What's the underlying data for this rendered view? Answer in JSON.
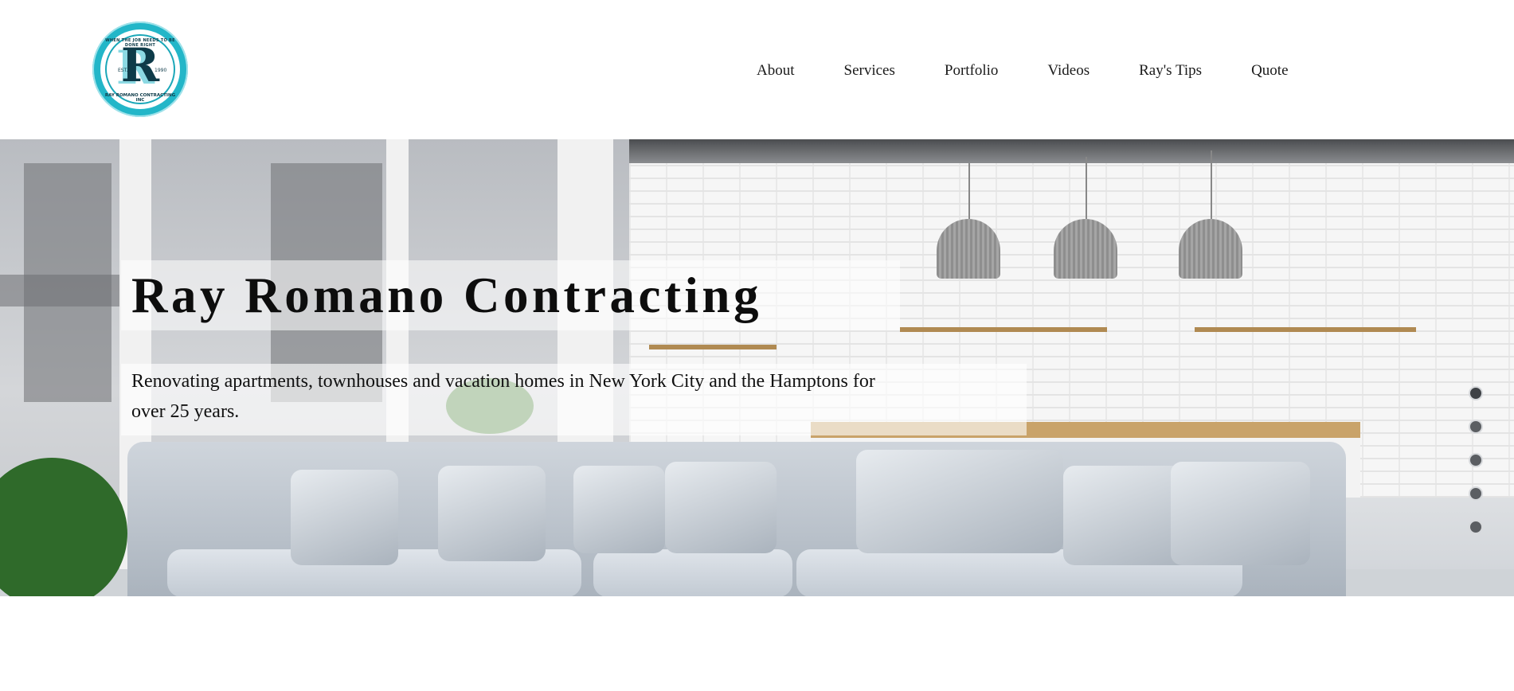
{
  "logo": {
    "letter": "R",
    "arc_top": "WHEN THE JOB NEEDS TO BE DONE RIGHT",
    "arc_bottom": "RAY ROMANO CONTRACTING INC",
    "est": "EST.",
    "year": "1990",
    "icon": "company-logo"
  },
  "nav": {
    "items": [
      {
        "label": "About"
      },
      {
        "label": "Services"
      },
      {
        "label": "Portfolio"
      },
      {
        "label": "Videos"
      },
      {
        "label": "Ray's Tips"
      },
      {
        "label": "Quote"
      }
    ]
  },
  "hero": {
    "title": "Ray Romano Contracting",
    "subtitle": "Renovating apartments, townhouses and vacation homes in New York City and the Hamptons for over 25 years.",
    "slider": {
      "count": 5,
      "active_index": 0
    }
  },
  "colors": {
    "logo_teal": "#23b6c8",
    "logo_navy": "#0e3b49",
    "text": "#1a1a1a",
    "dot": "#5b5e62"
  }
}
